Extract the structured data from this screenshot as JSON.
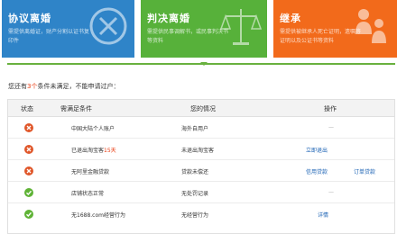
{
  "tiles": [
    {
      "title": "协议离婚",
      "desc": "需提供离婚证，财产分割以证书复印件",
      "icon": "close-circle-icon",
      "color": "#2f84c8"
    },
    {
      "title": "判决离婚",
      "desc": "需提供民事调解书，或民事判决书等资料",
      "icon": "balance-scale-icon",
      "color": "#57b13a"
    },
    {
      "title": "继承",
      "desc": "需提供被继承人死亡证明，遗嘱等证明以及公证书等资料",
      "icon": "family-icon",
      "color": "#f26a1b"
    }
  ],
  "notice": {
    "prefix": "您还有",
    "count": "3个",
    "suffix": "条件未满足，不能申请过户："
  },
  "table": {
    "headers": [
      "状态",
      "需满足条件",
      "您的情况",
      "操作"
    ],
    "rows": [
      {
        "status": "fail",
        "condition": "中国大陆个人账户",
        "condition_pre": "",
        "condition_hl": "",
        "condition_post": "",
        "situation": "海外自用户",
        "actions": [
          "—"
        ]
      },
      {
        "status": "fail",
        "condition_pre": "已退出淘宝客",
        "condition_hl": "15天",
        "condition_post": "",
        "condition": "",
        "situation": "未退出淘宝客",
        "actions": [
          "立即退出"
        ]
      },
      {
        "status": "fail",
        "condition": "无阿里金融贷款",
        "condition_pre": "",
        "condition_hl": "",
        "condition_post": "",
        "situation": "贷款未偿还",
        "actions": [
          "信用贷款",
          "订单贷款"
        ]
      },
      {
        "status": "ok",
        "condition": "店铺状态正常",
        "condition_pre": "",
        "condition_hl": "",
        "condition_post": "",
        "situation": "无处罚记录",
        "actions": [
          "—"
        ]
      },
      {
        "status": "ok",
        "condition": "无1688.com经营行为",
        "condition_pre": "",
        "condition_hl": "",
        "condition_post": "",
        "situation": "无经营行为",
        "actions": [
          "详情"
        ]
      }
    ]
  },
  "colors": {
    "accent_line": "#69b13f",
    "fail": "#e0572a",
    "ok": "#5fb336",
    "link": "#1b62b4",
    "highlight": "#e8380d"
  }
}
